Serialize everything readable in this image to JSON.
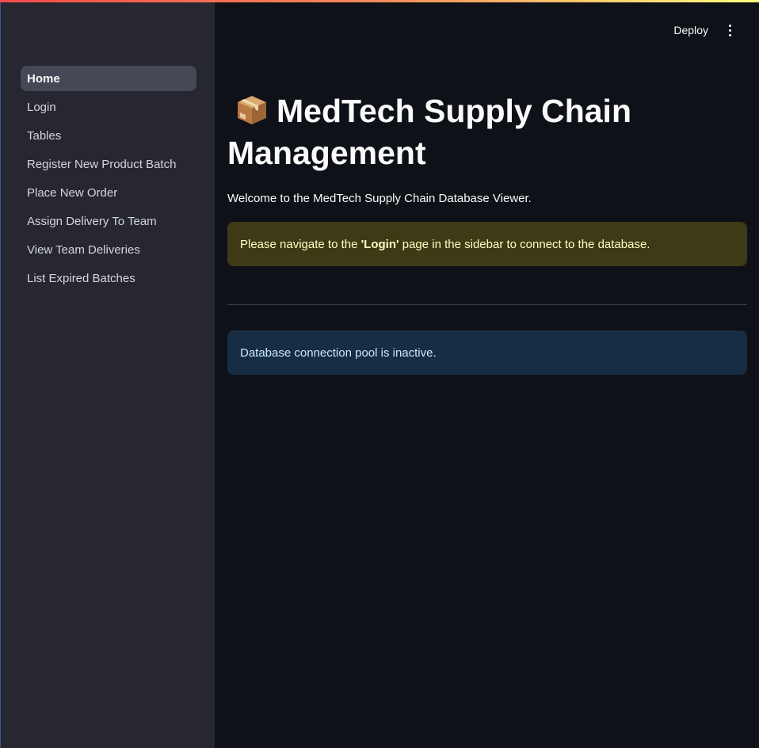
{
  "sidebar": {
    "items": [
      {
        "label": "Home",
        "active": true
      },
      {
        "label": "Login"
      },
      {
        "label": "Tables"
      },
      {
        "label": "Register New Product Batch"
      },
      {
        "label": "Place New Order"
      },
      {
        "label": "Assign Delivery To Team"
      },
      {
        "label": "View Team Deliveries"
      },
      {
        "label": "List Expired Batches"
      }
    ]
  },
  "header": {
    "deploy_label": "Deploy",
    "menu_icon": "vertical-ellipsis-icon"
  },
  "main": {
    "title_icon": "package-icon",
    "title": "MedTech Supply Chain Management",
    "welcome": "Welcome to the MedTech Supply Chain Database Viewer.",
    "warning": {
      "prefix": "Please navigate to the ",
      "emphasis": "'Login'",
      "suffix": " page in the sidebar to connect to the database."
    },
    "info": "Database connection pool is inactive."
  },
  "colors": {
    "background": "#0e1117",
    "sidebar": "#262730",
    "warning_bg": "#3e3a16",
    "info_bg": "#172d43"
  }
}
